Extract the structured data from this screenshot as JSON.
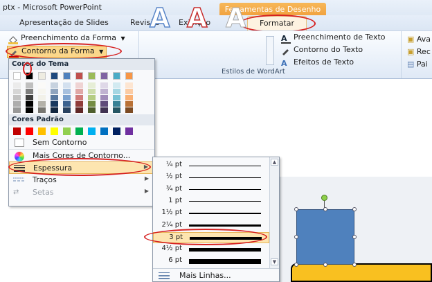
{
  "title_bar": {
    "text": "ptx - Microsoft PowerPoint"
  },
  "context_header": {
    "label": "Ferramentas de Desenho"
  },
  "tabs": [
    {
      "label": "Apresentação de Slides"
    },
    {
      "label": "Revisão"
    },
    {
      "label": "Exibição"
    },
    {
      "label": "Formatar"
    }
  ],
  "ribbon": {
    "fill_button": "Preenchimento da Forma",
    "outline_button": "Contorno da Forma",
    "text_fill": "Preenchimento de Texto",
    "text_outline": "Contorno do Texto",
    "text_effects": "Efeitos de Texto",
    "wordart_group_label": "Estilos de WordArt",
    "wordart_glyph": "A",
    "right_items": [
      "Ava",
      "Rec",
      "Pai"
    ]
  },
  "dropdown": {
    "theme_colors_header": "Cores do Tema",
    "standard_colors_header": "Cores Padrão",
    "no_outline": "Sem Contorno",
    "more_colors": "Mais Cores de Contorno...",
    "weight": "Espessura",
    "dashes": "Traços",
    "arrows": "Setas",
    "theme_top_row": [
      "#ffffff",
      "#000000",
      "#eeece1",
      "#1f497d",
      "#4f81bd",
      "#c0504d",
      "#9bbb59",
      "#8064a2",
      "#4bacc6",
      "#f79646"
    ],
    "standard_colors": [
      "#c00000",
      "#ff0000",
      "#ffc000",
      "#ffff00",
      "#92d050",
      "#00b050",
      "#00b0f0",
      "#0070c0",
      "#002060",
      "#7030a0"
    ]
  },
  "weights": {
    "items": [
      {
        "label": "¼ pt",
        "pt": 0.25
      },
      {
        "label": "½ pt",
        "pt": 0.5
      },
      {
        "label": "¾ pt",
        "pt": 0.75
      },
      {
        "label": "1 pt",
        "pt": 1
      },
      {
        "label": "1½ pt",
        "pt": 1.5
      },
      {
        "label": "2¼ pt",
        "pt": 2.25
      },
      {
        "label": "3 pt",
        "pt": 3
      },
      {
        "label": "4½ pt",
        "pt": 4.5
      },
      {
        "label": "6 pt",
        "pt": 6
      }
    ],
    "more_lines": "Mais Linhas...",
    "selected": "3 pt"
  },
  "colors": {
    "shape_fill": "#4f81bd",
    "accent_orange": "#f3a43f",
    "ellipse_red": "#d62020"
  }
}
